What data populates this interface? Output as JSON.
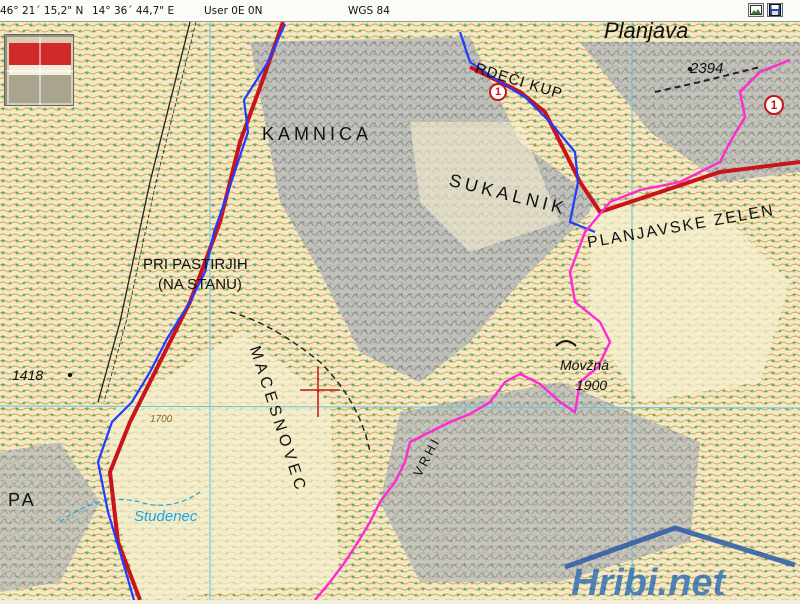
{
  "statusbar": {
    "latitude": "46° 21´ 15,2\" N",
    "longitude": "14° 36´ 44,7\" E",
    "user_coords": "User 0E  0N",
    "datum": "WGS 84",
    "image_icon": "image-icon",
    "save_icon": "save-icon"
  },
  "map": {
    "labels": {
      "kamnica": "KAMNICA",
      "rdeci_kup": "RDEČI KUP",
      "sukalnik": "SUKALNIK",
      "planjavske": "PLANJAVSKE ZELEN",
      "pri_pastirjih": "PRI PASTIRJIH",
      "na_stanu": "(NA STANU)",
      "macesnovec": "MACESNOVEC",
      "studenec": "Studenec",
      "movzna": "Movžna",
      "elev_1900": "1900",
      "elev_1418": "1418",
      "elev_2394": "2394",
      "elev_1700": "1700",
      "pa": "PA",
      "planjava": "Planjava",
      "route_badge_1": "1",
      "route_badge_2": "1",
      "vrhi_fragment": "VRHI"
    },
    "colors": {
      "track_blue": "#1f3cff",
      "track_magenta": "#ff2ad4",
      "trail_red": "#c8141a",
      "contour_orange": "#d7a24a",
      "rock_grey": "#9ea3a6",
      "forest_green": "#1f8f3a",
      "grid_cyan": "#59c7e6",
      "water_blue": "#19a4e8"
    }
  },
  "watermark": {
    "brand": "Hribi.net"
  }
}
